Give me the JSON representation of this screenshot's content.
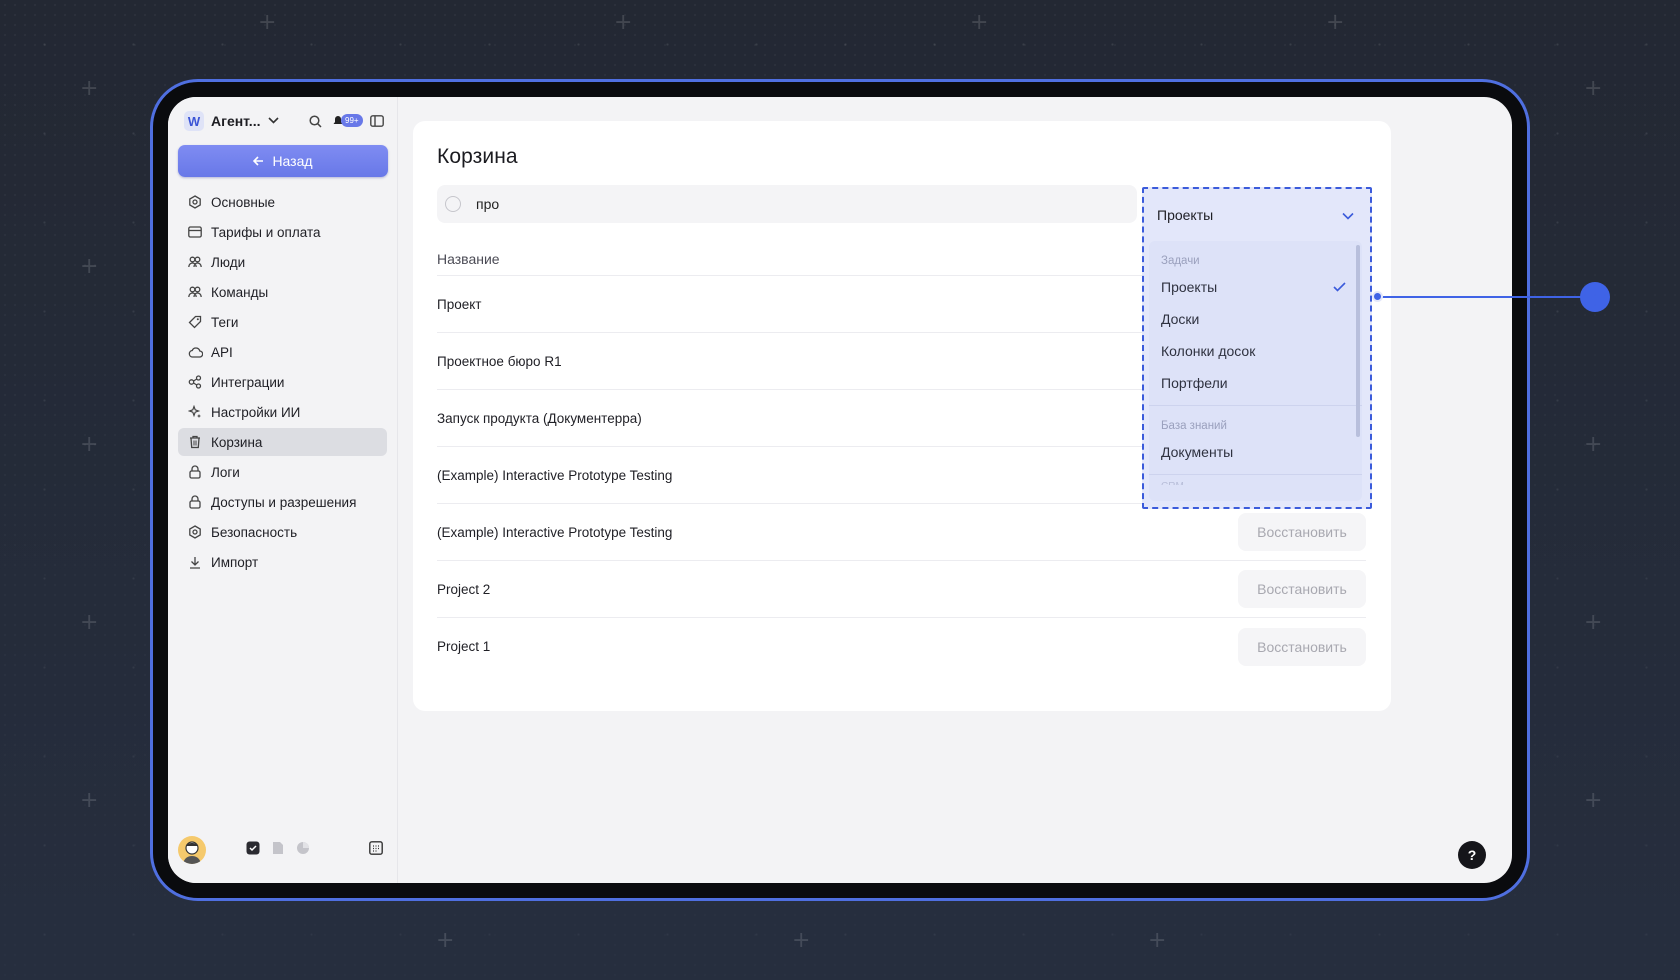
{
  "workspace": {
    "logo_letter": "W",
    "name": "Агент...",
    "notifications_badge": "99+"
  },
  "sidebar": {
    "back_label": "Назад",
    "items": [
      {
        "label": "Основные",
        "icon": "gear-icon"
      },
      {
        "label": "Тарифы и оплата",
        "icon": "card-icon"
      },
      {
        "label": "Люди",
        "icon": "people-icon"
      },
      {
        "label": "Команды",
        "icon": "team-icon"
      },
      {
        "label": "Теги",
        "icon": "tag-icon"
      },
      {
        "label": "API",
        "icon": "cloud-icon"
      },
      {
        "label": "Интеграции",
        "icon": "integrations-icon"
      },
      {
        "label": "Настройки ИИ",
        "icon": "sparkle-icon"
      },
      {
        "label": "Корзина",
        "icon": "trash-icon",
        "active": true
      },
      {
        "label": "Логи",
        "icon": "lock-icon"
      },
      {
        "label": "Доступы и разрешения",
        "icon": "lock-icon"
      },
      {
        "label": "Безопасность",
        "icon": "gear-icon"
      },
      {
        "label": "Импорт",
        "icon": "download-icon"
      }
    ]
  },
  "main": {
    "title": "Корзина",
    "search_value": "про",
    "column_name": "Название",
    "restore_label": "Восстановить",
    "rows": [
      {
        "name": "Проект"
      },
      {
        "name": "Проектное бюро R1"
      },
      {
        "name": "Запуск продукта (Документерра)"
      },
      {
        "name": "(Example) Interactive Prototype Testing"
      },
      {
        "name": "(Example) Interactive Prototype Testing"
      },
      {
        "name": "Project 2"
      },
      {
        "name": "Project 1"
      }
    ]
  },
  "dropdown": {
    "selected": "Проекты",
    "groups": [
      {
        "label": "Задачи",
        "options": [
          "Проекты",
          "Доски",
          "Колонки досок",
          "Портфели"
        ]
      },
      {
        "label": "База знаний",
        "options": [
          "Документы"
        ]
      },
      {
        "label": "CRM",
        "options": []
      }
    ]
  },
  "help_label": "?",
  "colors": {
    "accent": "#6878e8",
    "highlight": "#3f63e6",
    "frame": "#4f6fe0"
  }
}
